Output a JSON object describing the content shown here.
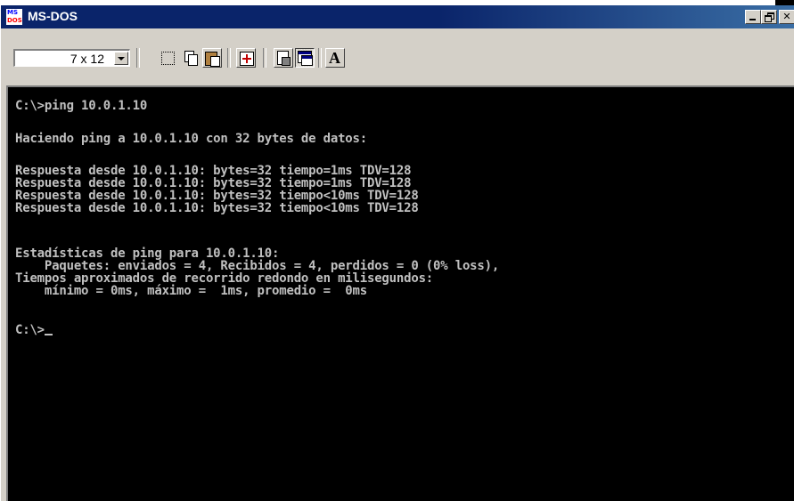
{
  "window": {
    "title": "MS-DOS",
    "icon": "ms-dos-icon",
    "icon_text": {
      "ms": "MS",
      "dos": "DOS"
    },
    "colors": {
      "titlebar": "#0a246a",
      "console_bg": "#000000",
      "console_text": "#c0c0c0"
    }
  },
  "toolbar": {
    "font_size": "7 x 12",
    "buttons": [
      {
        "icon": "mark-icon"
      },
      {
        "icon": "copy-icon"
      },
      {
        "icon": "paste-icon"
      },
      {
        "icon": "full-screen-icon"
      },
      {
        "icon": "properties-icon"
      },
      {
        "icon": "background-icon"
      },
      {
        "icon": "font-icon",
        "label": "A"
      }
    ]
  },
  "console": {
    "lines": [
      "C:\\>ping 10.0.1.10",
      "Haciendo ping a 10.0.1.10 con 32 bytes de datos:",
      "Respuesta desde 10.0.1.10: bytes=32 tiempo=1ms TDV=128",
      "Respuesta desde 10.0.1.10: bytes=32 tiempo=1ms TDV=128",
      "Respuesta desde 10.0.1.10: bytes=32 tiempo<10ms TDV=128",
      "Respuesta desde 10.0.1.10: bytes=32 tiempo<10ms TDV=128",
      "Estadísticas de ping para 10.0.1.10:",
      "    Paquetes: enviados = 4, Recibidos = 4, perdidos = 0 (0% loss),",
      "Tiempos aproximados de recorrido redondo en milisegundos:",
      "    mínimo = 0ms, máximo =  1ms, promedio =  0ms",
      "C:\\>"
    ]
  }
}
